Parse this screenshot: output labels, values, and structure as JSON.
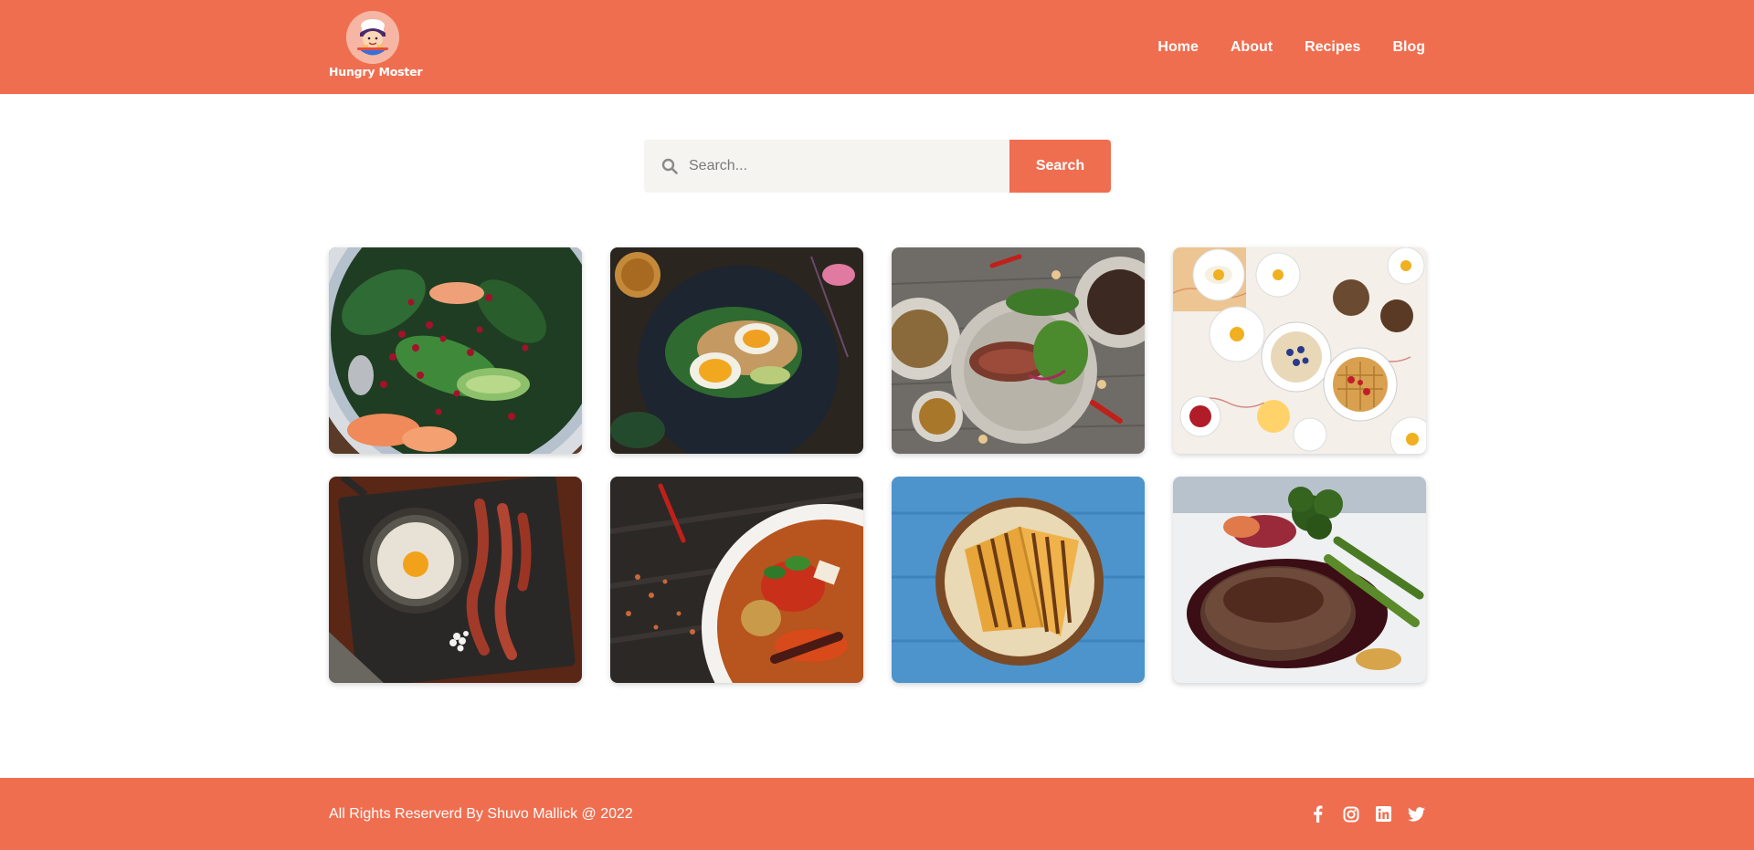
{
  "brand": {
    "name": "Hungry Moster",
    "primary_color": "#f06e50"
  },
  "nav": {
    "items": [
      {
        "label": "Home"
      },
      {
        "label": "About"
      },
      {
        "label": "Recipes"
      },
      {
        "label": "Blog"
      }
    ]
  },
  "search": {
    "placeholder": "Search...",
    "value": "",
    "button_label": "Search",
    "icon": "search-icon"
  },
  "recipes": [
    {
      "photo": "spinach-pomegranate-avocado-salad"
    },
    {
      "photo": "soft-boiled-eggs-avocado-toast"
    },
    {
      "photo": "sliced-steak-salad-bowls"
    },
    {
      "photo": "brunch-table-waffles-eggs"
    },
    {
      "photo": "fried-egg-skillet-bacon"
    },
    {
      "photo": "red-curry-bowl-chilies"
    },
    {
      "photo": "grilled-sandwich-on-blue-table"
    },
    {
      "photo": "steak-with-broccolini"
    }
  ],
  "footer": {
    "copyright": "All Rights Reserverd By Shuvo Mallick @ 2022",
    "social_icons": [
      "facebook-icon",
      "instagram-icon",
      "linkedin-icon",
      "twitter-icon"
    ]
  }
}
